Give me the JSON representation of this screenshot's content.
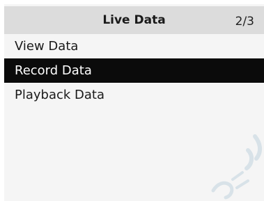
{
  "header": {
    "title": "Live Data",
    "page_indicator": "2/3"
  },
  "menu": {
    "items": [
      {
        "label": "View Data",
        "selected": false
      },
      {
        "label": "Record Data",
        "selected": true
      },
      {
        "label": "Playback Data",
        "selected": false
      }
    ]
  },
  "colors": {
    "header_bg": "#dcdcdc",
    "screen_bg": "#f5f5f5",
    "selected_bg": "#0b0b0b",
    "selected_text": "#ffffff",
    "text": "#1a1a1a"
  },
  "icons": {
    "watermark": "logo-watermark-icon"
  }
}
